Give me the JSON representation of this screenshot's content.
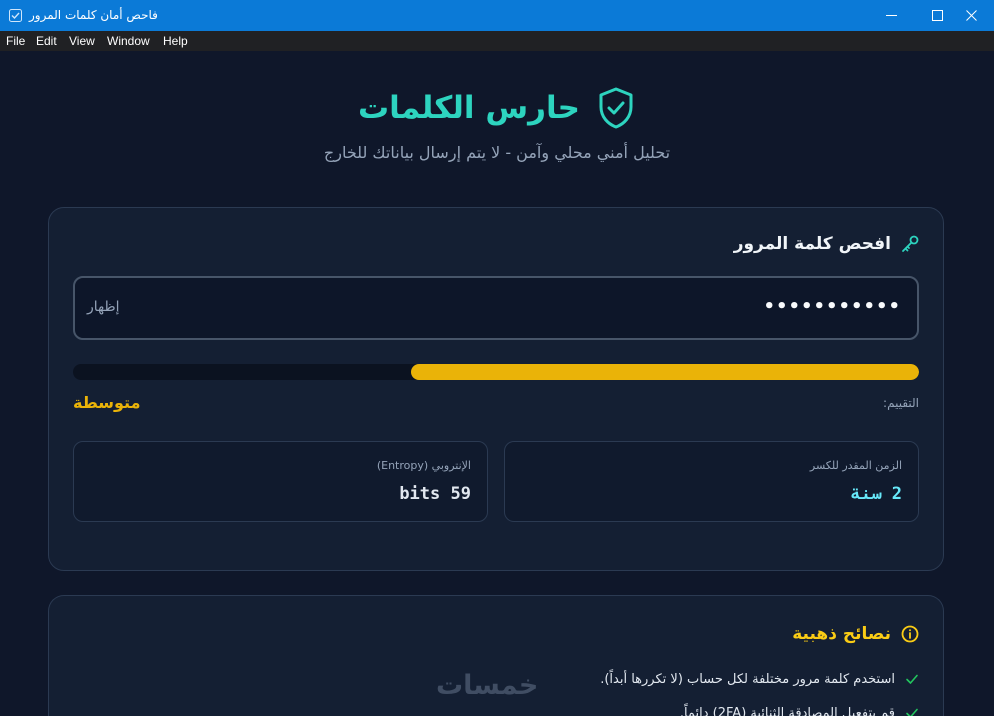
{
  "window": {
    "title": "فاحص أمان كلمات المرور"
  },
  "menu": [
    "File",
    "Edit",
    "View",
    "Window",
    "Help"
  ],
  "header": {
    "app_name": "حارس الكلمات",
    "subtitle": "تحليل أمني محلي وآمن - لا يتم إرسال بياناتك للخارج"
  },
  "checker": {
    "title": "افحص كلمة المرور",
    "password_masked": "•••••••••••",
    "show_label": "إظهار",
    "strength_fraction": 0.6,
    "rating_label": "التقييم:",
    "rating_value": "متوسطة",
    "crack_time_label": "الزمن المقدر للكسر",
    "crack_time_value": "2 سنة",
    "entropy_label": "الإنتروبي (Entropy)",
    "entropy_value": "59 bits"
  },
  "tips": {
    "title": "نصائح ذهبية",
    "items": [
      "استخدم كلمة مرور مختلفة لكل حساب (لا تكررها أبداً).",
      "قم بتفعيل المصادقة الثنائية (2FA) دائماً."
    ]
  },
  "watermark": "خمسات",
  "colors": {
    "accent": "#2dd4bf",
    "medium": "#eab308",
    "time": "#67e8f9",
    "tips": "#facc15",
    "check": "#22c55e"
  }
}
